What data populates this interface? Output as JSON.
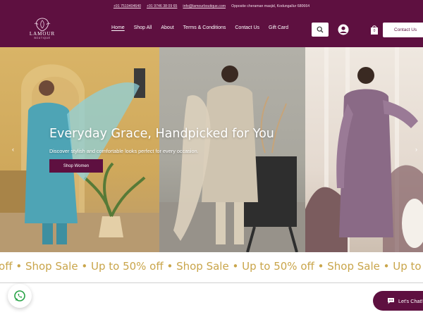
{
  "topbar": {
    "phone1": "+91 7510404640",
    "phone2": "+91 9746 38 09 65",
    "email": "info@lamourboutique.com",
    "address": "Opposite cheraman masjid, Kodungallur 680664"
  },
  "brand": {
    "name": "LAMOUR",
    "tagline": "BOUTIQUE",
    "color": "#5e1040",
    "accent": "#c9a54a"
  },
  "nav": {
    "items": [
      {
        "label": "Home",
        "active": true
      },
      {
        "label": "Shop All"
      },
      {
        "label": "About"
      },
      {
        "label": "Terms & Conditions"
      },
      {
        "label": "Contact Us"
      },
      {
        "label": "Gift Card"
      }
    ],
    "cart_count": "0",
    "contact_button": "Contact Us",
    "icons": [
      "search-icon",
      "user-icon",
      "shopping-bag-icon"
    ]
  },
  "hero": {
    "headline": "Everyday Grace, Handpicked for You",
    "subline": "Discover stylish and comfortable looks perfect for every occasion.",
    "cta": "Shop Women",
    "prev_arrow": "‹",
    "next_arrow": "›"
  },
  "marquee": {
    "items": [
      "% off",
      "Shop Sale",
      "Up to 50% off",
      "Shop Sale",
      "Up to 50% off",
      "Shop Sale",
      "Up to 50%"
    ],
    "separator": "•"
  },
  "chat": {
    "label": "Let's Chat!"
  }
}
